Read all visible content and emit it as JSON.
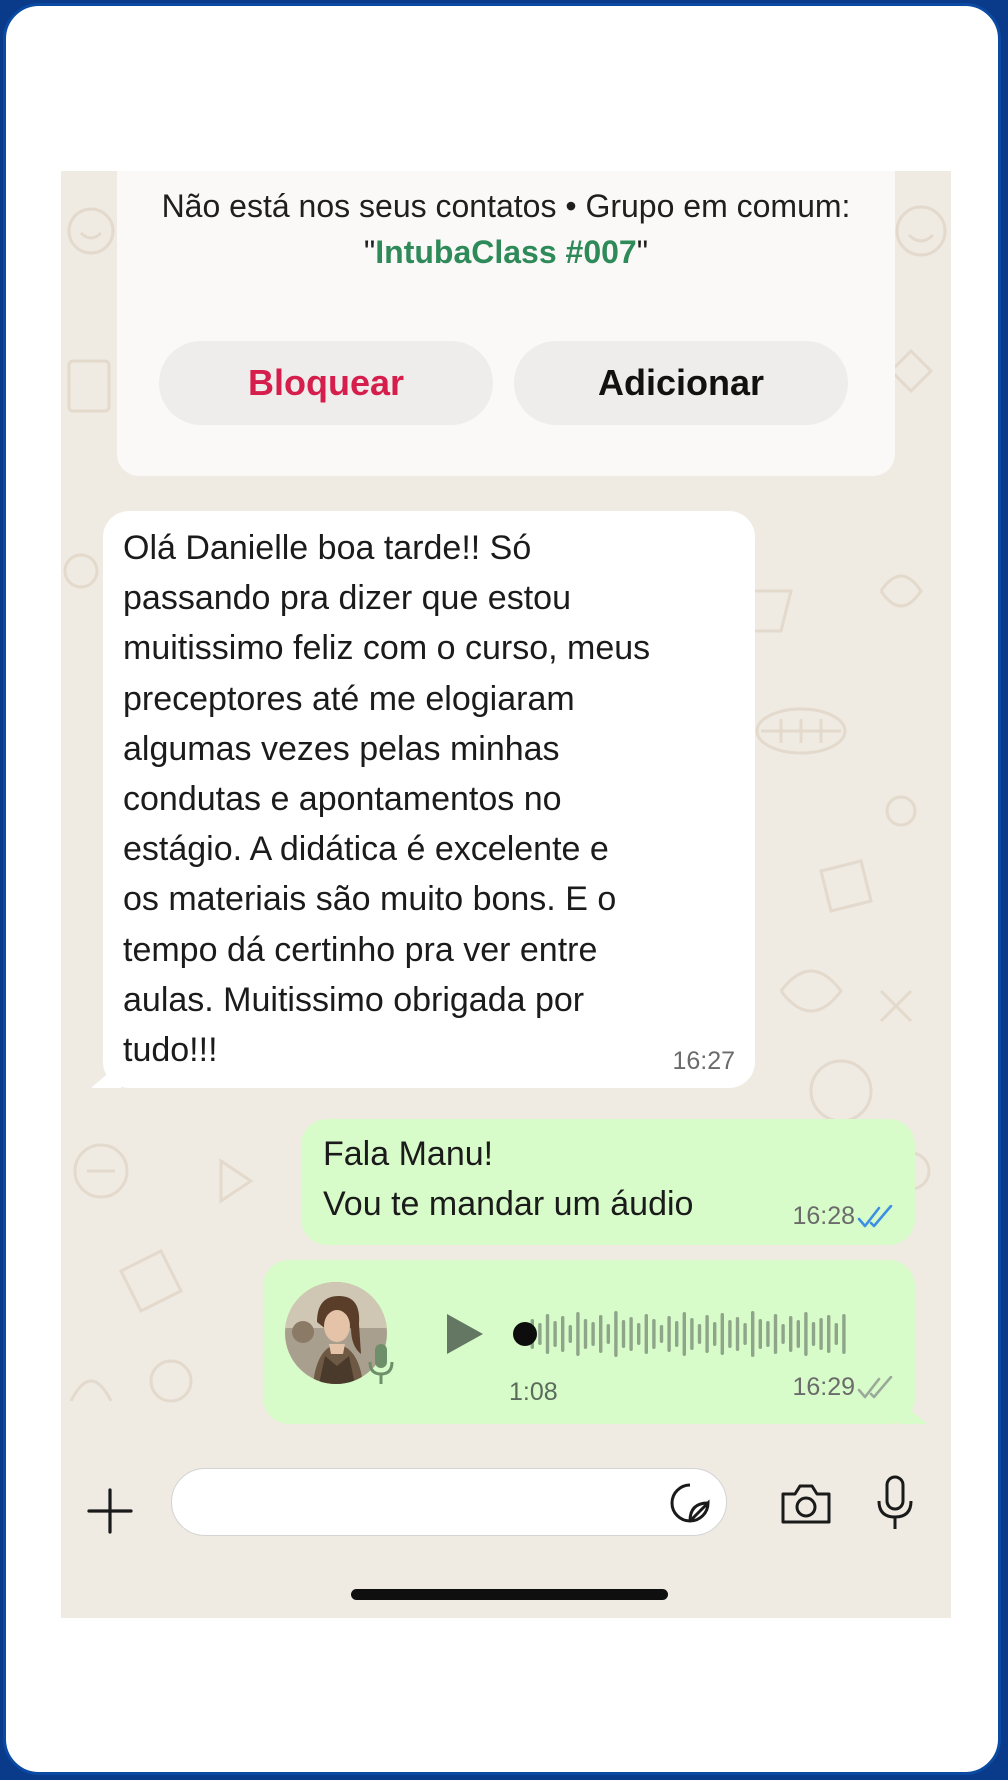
{
  "contact_info": {
    "note_prefix": "Não está nos seus contatos • Grupo em comum: \"",
    "group_name": "IntubaClass #007",
    "note_suffix": "\"",
    "block_label": "Bloquear",
    "add_label": "Adicionar"
  },
  "messages": [
    {
      "direction": "incoming",
      "text": "Olá Danielle boa tarde!! Só\npassando pra dizer que estou\nmuitissimo feliz com o curso, meus\npreceptores até me elogiaram\nalgumas vezes pelas minhas\ncondutas e apontamentos no\nestágio. A didática é excelente e\nos materiais são muito bons. E o\ntempo dá certinho pra ver entre\naulas. Muitissimo obrigada por\ntudo!!!",
      "time": "16:27"
    },
    {
      "direction": "outgoing",
      "text": "Fala Manu!\nVou te mandar um áudio",
      "time": "16:28",
      "status": "read"
    },
    {
      "direction": "outgoing",
      "type": "voice",
      "duration": "1:08",
      "time": "16:29",
      "status": "delivered",
      "playback_progress": 0
    }
  ],
  "input_bar": {
    "placeholder": "",
    "icons": [
      "plus-icon",
      "sticker-icon",
      "camera-icon",
      "microphone-icon"
    ]
  },
  "colors": {
    "chat_background": "#efeae2",
    "incoming_bubble": "#ffffff",
    "outgoing_bubble": "#d7fbc9",
    "group_link": "#2f8a5a",
    "block_text": "#d51e4c",
    "read_ticks": "#3b8fe4",
    "frame_border": "#0b4aa2"
  }
}
